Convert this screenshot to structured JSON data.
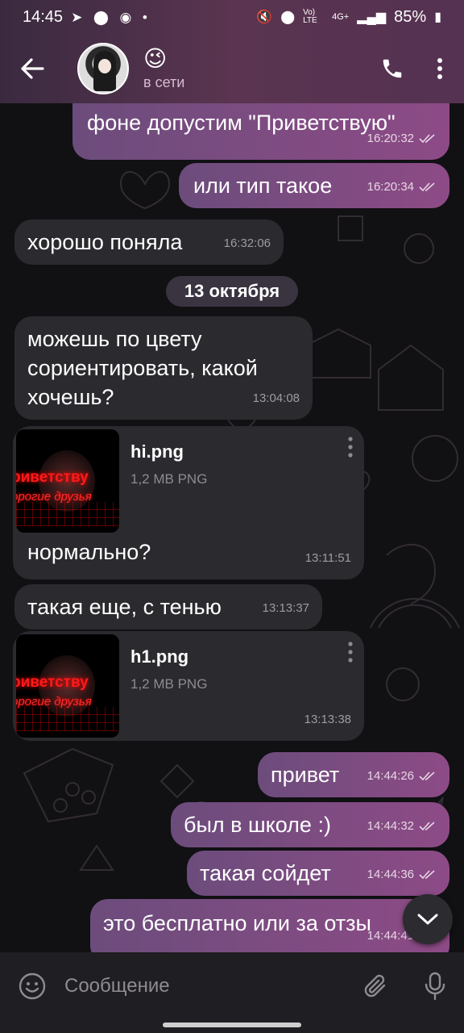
{
  "status_bar": {
    "time": "14:45",
    "battery": "85%",
    "network": "4G+",
    "volte": "Vo) LTE"
  },
  "header": {
    "emoji": "😉",
    "status": "в сети"
  },
  "messages": [
    {
      "id": "m1",
      "dir": "out",
      "text": "фоне допустим \"Приветствую\"",
      "time": "16:20:32"
    },
    {
      "id": "m2",
      "dir": "out",
      "text": "или тип такое",
      "time": "16:20:34"
    },
    {
      "id": "m3",
      "dir": "in",
      "text": "хорошо поняла",
      "time": "16:32:06"
    },
    {
      "id": "m4",
      "dir": "in",
      "text": "можешь по цвету сориентировать, какой хочешь?",
      "time": "13:04:08"
    },
    {
      "id": "m5",
      "dir": "in",
      "file": "hi.png",
      "size": "1,2 MB PNG",
      "text": "нормально?",
      "time": "13:11:51"
    },
    {
      "id": "m6",
      "dir": "in",
      "text": "такая еще, с тенью",
      "time": "13:13:37"
    },
    {
      "id": "m7",
      "dir": "in",
      "file": "h1.png",
      "size": "1,2 MB PNG",
      "time": "13:13:38"
    },
    {
      "id": "m8",
      "dir": "out",
      "text": "привет",
      "time": "14:44:26"
    },
    {
      "id": "m9",
      "dir": "out",
      "text": "был в школе :)",
      "time": "14:44:32"
    },
    {
      "id": "m10",
      "dir": "out",
      "text": "такая сойдет",
      "time": "14:44:36"
    },
    {
      "id": "m11",
      "dir": "out",
      "text": "это бесплатно или за отзы",
      "time": "14:44:41"
    }
  ],
  "date_separator": "13 октября",
  "thumbnail": {
    "line1": "риветству",
    "line2": "орогие друзья"
  },
  "composer": {
    "placeholder": "Сообщение"
  },
  "colors": {
    "accent_out": "#8d4b86",
    "incoming": "#2b2a2e",
    "header": "#4a3049"
  },
  "icons": [
    "back-arrow-icon",
    "phone-icon",
    "more-vert-icon",
    "emoji-icon",
    "attach-icon",
    "mic-icon",
    "scroll-down-icon",
    "read-ticks-icon"
  ]
}
